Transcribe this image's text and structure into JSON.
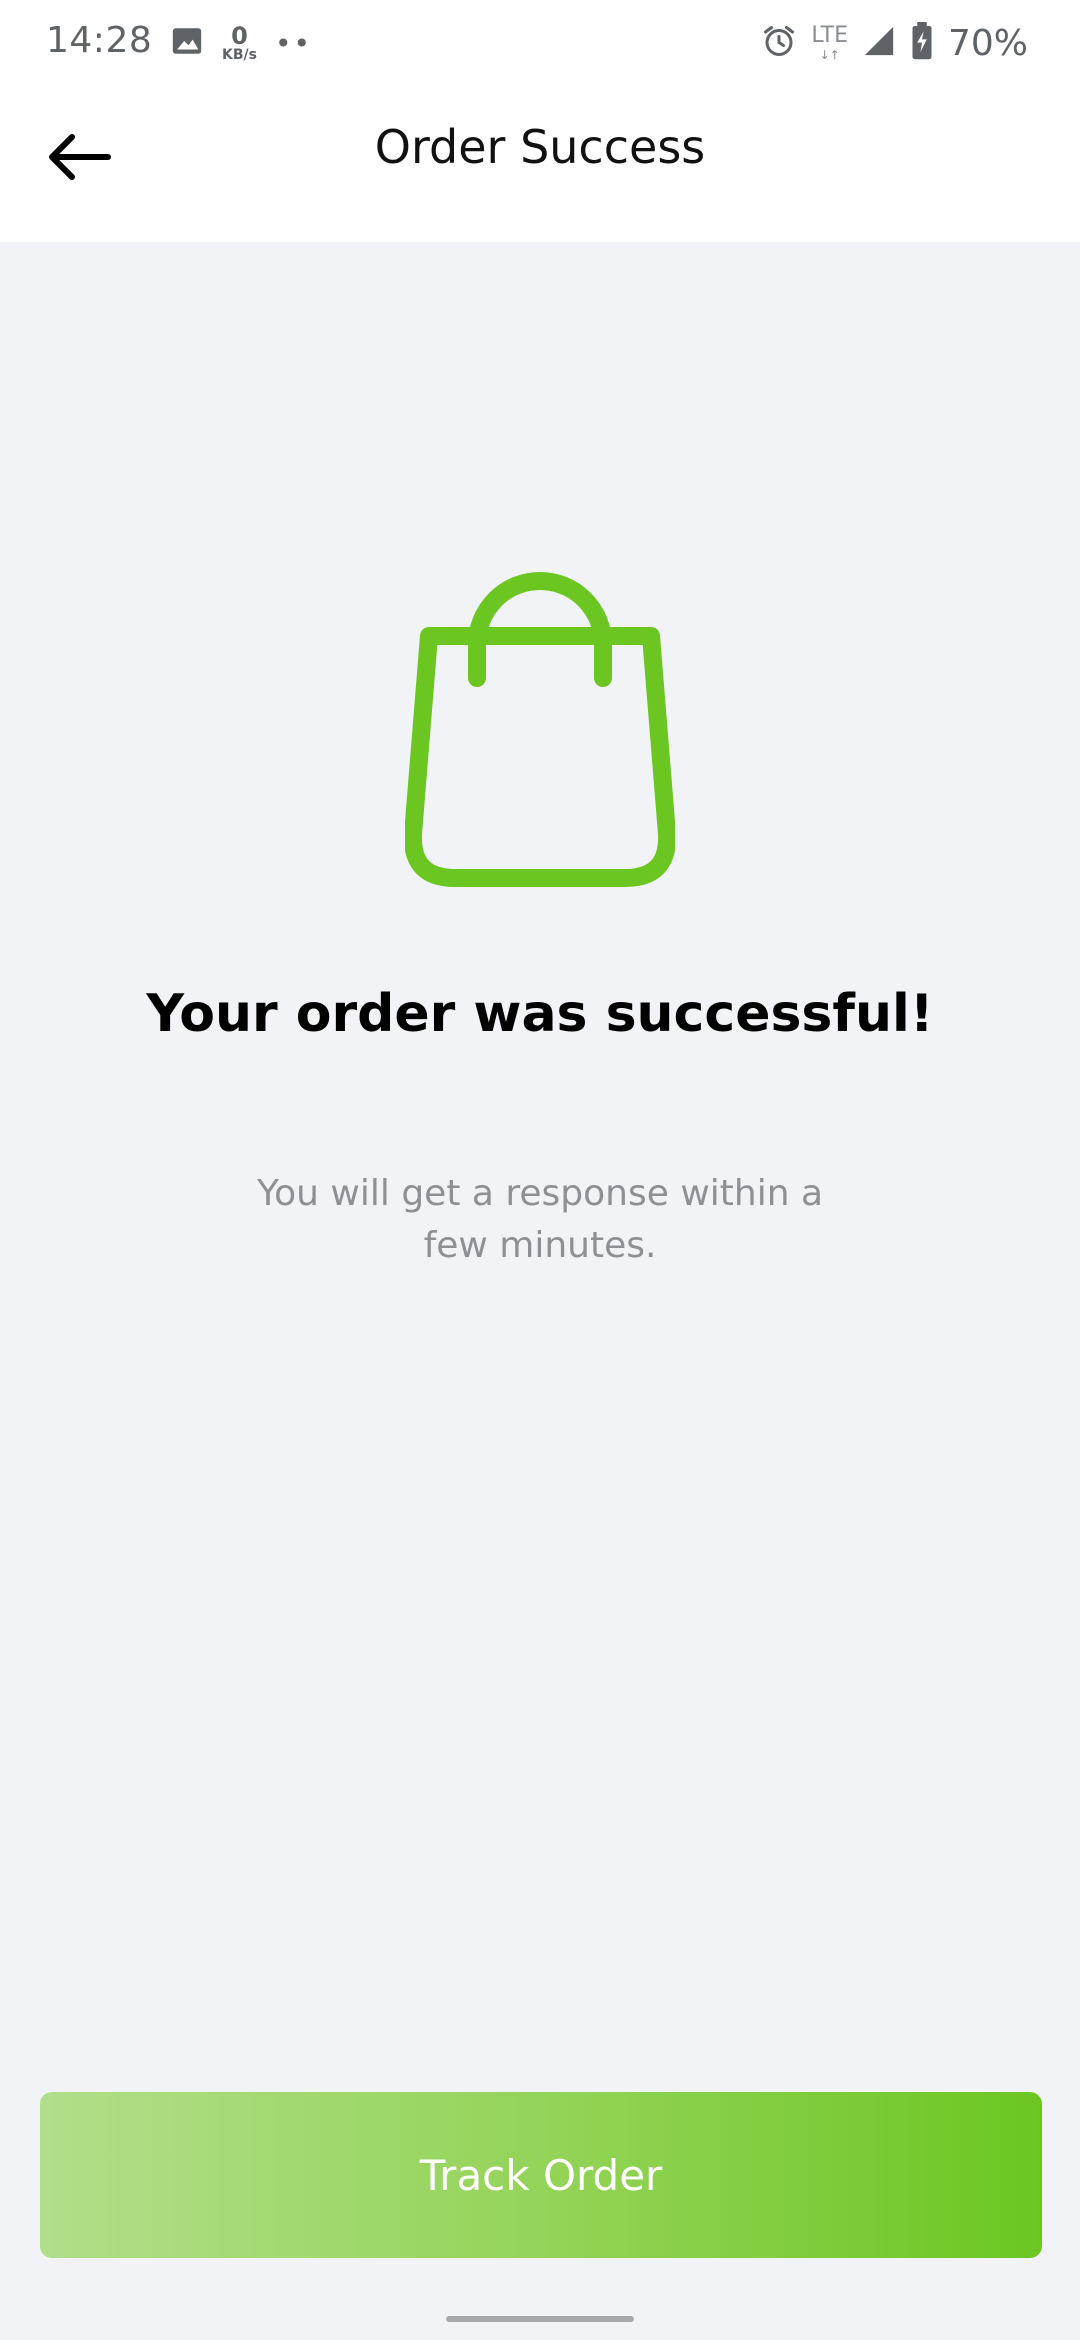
{
  "status_bar": {
    "time": "14:28",
    "net_speed_value": "0",
    "net_speed_unit": "KB/s",
    "dots": "••",
    "network_type": "LTE",
    "network_arrows": "↓↑",
    "battery_percent": "70%"
  },
  "app_bar": {
    "title": "Order Success"
  },
  "content": {
    "headline": "Your order was successful!",
    "subtext": "You will get a response within a few minutes.",
    "icon": "shopping-bag-icon"
  },
  "actions": {
    "track_order_label": "Track Order"
  },
  "colors": {
    "accent": "#6CC622",
    "accent_light": "#B1DE8A",
    "background": "#F2F3F7",
    "headline": "#000000",
    "subtext": "#8E9096"
  }
}
